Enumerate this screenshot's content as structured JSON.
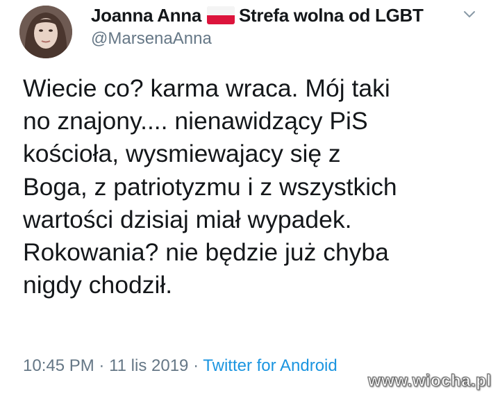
{
  "author": {
    "display_name": "Joanna Anna",
    "name_suffix": "Strefa wolna od LGBT",
    "handle": "@MarsenaAnna",
    "avatar_icon": "user-avatar-photo"
  },
  "header": {
    "flag_icon": "poland-flag-icon",
    "menu_icon": "chevron-down-icon"
  },
  "tweet": {
    "text_lines": [
      "Wiecie co? karma wraca. Mój taki",
      "no znajony.... nienawidzący PiS",
      "kościoła, wysmiewajacy się z",
      "Boga, z patriotyzmu i z wszystkich",
      "wartości dzisiaj miał wypadek.",
      "Rokowania? nie będzie już chyba",
      "nigdy chodził."
    ]
  },
  "meta": {
    "time": "10:45 PM",
    "separator": "·",
    "date": "11 lis 2019",
    "source": "Twitter for Android"
  },
  "watermark": "www.wiocha.pl",
  "colors": {
    "text": "#14171a",
    "secondary": "#657786",
    "link": "#1b95e0",
    "flag_white": "#f4f4f4",
    "flag_red": "#dc143c"
  }
}
